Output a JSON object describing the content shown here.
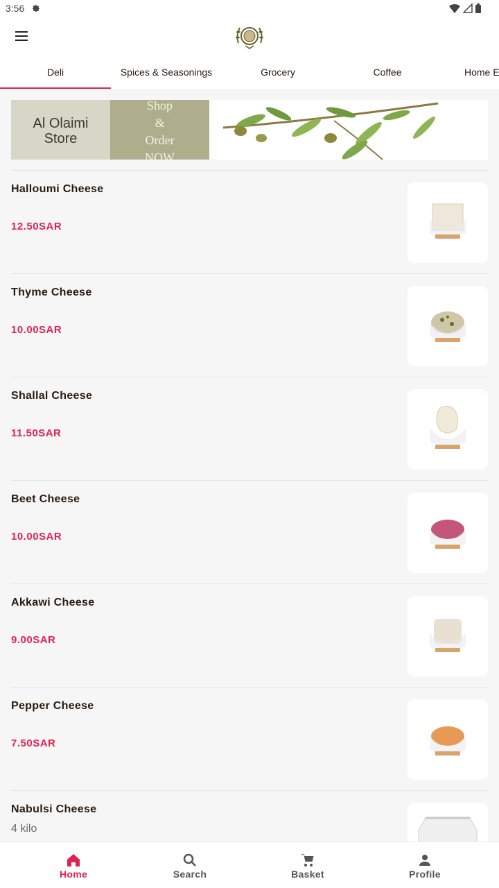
{
  "status": {
    "time": "3:56"
  },
  "app": {
    "logo_icon": "olive-wreath-logo"
  },
  "tabs": [
    {
      "label": "Deli",
      "active": true
    },
    {
      "label": "Spices & Seasonings"
    },
    {
      "label": "Grocery"
    },
    {
      "label": "Coffee"
    },
    {
      "label": "Home Essentials"
    }
  ],
  "banner": {
    "store_name_line1": "Al Olaimi",
    "store_name_line2": "Store",
    "cta_line1": "Shop",
    "cta_line2": "&",
    "cta_line3": "Order",
    "cta_line4": "NOW"
  },
  "products": [
    {
      "name": "Halloumi Cheese",
      "price": "12.50SAR",
      "image_icon": "halloumi-cheese-image"
    },
    {
      "name": "Thyme Cheese",
      "price": "10.00SAR",
      "image_icon": "thyme-cheese-image"
    },
    {
      "name": "Shallal Cheese",
      "price": "11.50SAR",
      "image_icon": "shallal-cheese-image"
    },
    {
      "name": "Beet Cheese",
      "price": "10.00SAR",
      "image_icon": "beet-cheese-image"
    },
    {
      "name": "Akkawi Cheese",
      "price": "9.00SAR",
      "image_icon": "akkawi-cheese-image"
    },
    {
      "name": "Pepper Cheese",
      "price": "7.50SAR",
      "image_icon": "pepper-cheese-image"
    },
    {
      "name": "Nabulsi Cheese",
      "subtitle": "4 kilo",
      "image_icon": "nabulsi-cheese-image"
    }
  ],
  "nav": {
    "home": "Home",
    "search": "Search",
    "basket": "Basket",
    "profile": "Profile"
  },
  "colors": {
    "accent": "#e02250",
    "text": "#2a1a10",
    "background": "#f6f6f6"
  }
}
